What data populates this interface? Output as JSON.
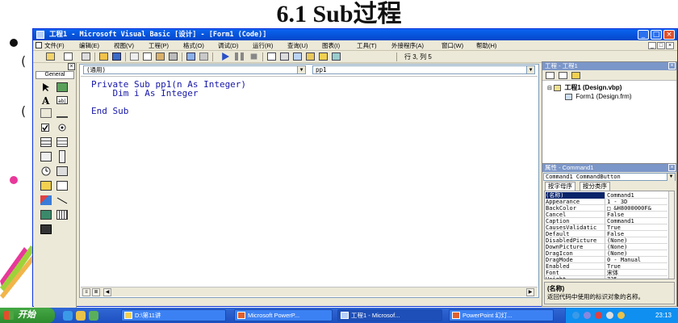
{
  "slide": {
    "title": "6.1 Sub过程",
    "marks": [
      "(",
      "("
    ],
    "colors": {
      "bullet": "#111111",
      "pink_bullet": "#e8389a"
    }
  },
  "window": {
    "title": "工程1 - Microsoft Visual Basic [设计] - [Form1 (Code)]",
    "controls": {
      "minimize": "_",
      "maximize": "□",
      "close": "×"
    },
    "colors": {
      "titlebar": "#0a5be8",
      "code_text": "#1717a8"
    }
  },
  "menu": {
    "items": [
      "文件(F)",
      "编辑(E)",
      "视图(V)",
      "工程(P)",
      "格式(O)",
      "调试(D)",
      "运行(R)",
      "查询(U)",
      "图表(I)",
      "工具(T)",
      "外接程序(A)",
      "窗口(W)",
      "帮助(H)"
    ],
    "mdi_controls": [
      "_",
      "□",
      "×"
    ]
  },
  "toolbar": {
    "icons": [
      "add-project-icon",
      "add-form-icon",
      "menu-editor-icon",
      "open-icon",
      "save-icon",
      "cut-icon",
      "copy-icon",
      "paste-icon",
      "find-icon",
      "undo-icon",
      "redo-icon",
      "start-icon",
      "pause-icon",
      "stop-icon",
      "project-explorer-icon",
      "properties-icon",
      "form-layout-icon",
      "object-browser-icon",
      "toolbox-icon",
      "data-view-icon"
    ],
    "status": "行 3, 列 5"
  },
  "toolbox": {
    "close": "×",
    "tab": "General"
  },
  "code": {
    "object_combo": "(通用)",
    "procedure_combo": "pp1",
    "lines": [
      "Private Sub pp1(n As Integer)",
      "    Dim i As Integer",
      "",
      "End Sub"
    ]
  },
  "project": {
    "title": "工程 - 工程1",
    "close": "×",
    "tree": [
      "工程1 (Design.vbp)",
      "Form1 (Design.frm)"
    ]
  },
  "properties": {
    "title": "属性 - Command1",
    "close": "×",
    "object": "Command1 CommandButton",
    "tabs": [
      "按字母序",
      "按分类序"
    ],
    "rows": [
      {
        "name": "(名称)",
        "value": "Command1"
      },
      {
        "name": "Appearance",
        "value": "1 - 3D"
      },
      {
        "name": "BackColor",
        "value": "□ &H8000000F&"
      },
      {
        "name": "Cancel",
        "value": "False"
      },
      {
        "name": "Caption",
        "value": "Command1"
      },
      {
        "name": "CausesValidatic",
        "value": "True"
      },
      {
        "name": "Default",
        "value": "False"
      },
      {
        "name": "DisabledPicture",
        "value": "(None)"
      },
      {
        "name": "DownPicture",
        "value": "(None)"
      },
      {
        "name": "DragIcon",
        "value": "(None)"
      },
      {
        "name": "DragMode",
        "value": "0 - Manual"
      },
      {
        "name": "Enabled",
        "value": "True"
      },
      {
        "name": "Font",
        "value": "宋体"
      },
      {
        "name": "Height",
        "value": "735"
      }
    ],
    "desc_title": "(名称)",
    "desc_text": "返回代码中使用的标识对象的名称。"
  },
  "taskbar": {
    "start": "开始",
    "tasks": [
      "D:\\第11讲",
      "Microsoft PowerP...",
      "工程1 - Microsof...",
      "PowerPoint 幻灯..."
    ],
    "clock": "23:13"
  }
}
